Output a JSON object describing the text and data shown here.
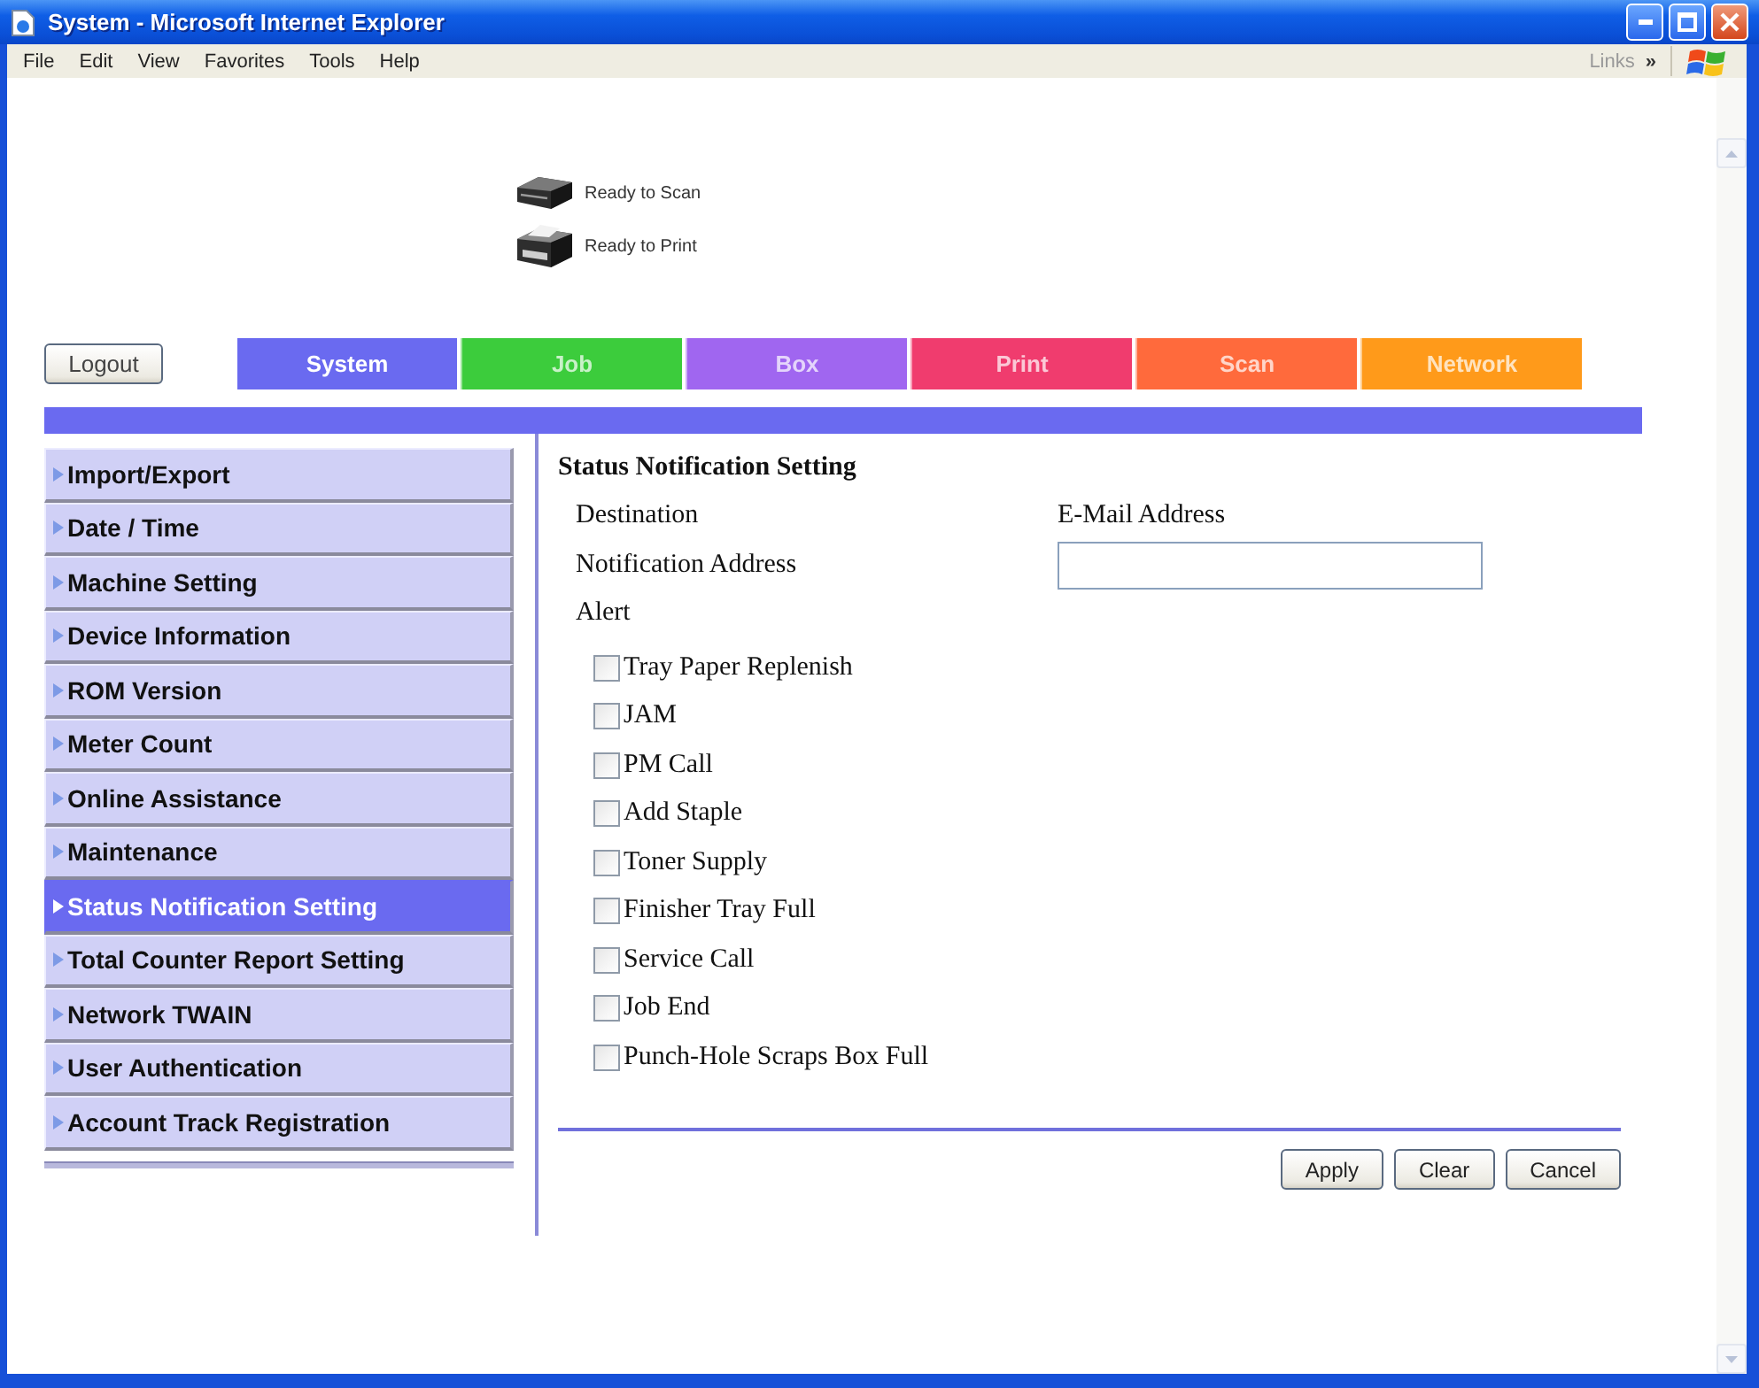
{
  "window": {
    "title": "System - Microsoft Internet Explorer"
  },
  "menu_bar": {
    "items": [
      "File",
      "Edit",
      "View",
      "Favorites",
      "Tools",
      "Help"
    ],
    "links": "Links",
    "chevron": "»"
  },
  "status": [
    {
      "kind": "scanner",
      "text": "Ready to Scan"
    },
    {
      "kind": "printer",
      "text": "Ready to Print"
    }
  ],
  "logout_button": "Logout",
  "tabs": [
    {
      "label": "System",
      "color": "#6a6af0",
      "selected": true
    },
    {
      "label": "Job",
      "color": "#3ccc3c",
      "selected": false
    },
    {
      "label": "Box",
      "color": "#a066f0",
      "selected": false
    },
    {
      "label": "Print",
      "color": "#f03c6e",
      "selected": false
    },
    {
      "label": "Scan",
      "color": "#ff6a3c",
      "selected": false
    },
    {
      "label": "Network",
      "color": "#ff9a1a",
      "selected": false
    }
  ],
  "sidebar": {
    "items": [
      {
        "label": "Import/Export",
        "selected": false
      },
      {
        "label": "Date / Time",
        "selected": false
      },
      {
        "label": "Machine Setting",
        "selected": false
      },
      {
        "label": "Device Information",
        "selected": false
      },
      {
        "label": "ROM Version",
        "selected": false
      },
      {
        "label": "Meter Count",
        "selected": false
      },
      {
        "label": "Online Assistance",
        "selected": false
      },
      {
        "label": "Maintenance",
        "selected": false
      },
      {
        "label": "Status Notification Setting",
        "selected": true
      },
      {
        "label": "Total Counter Report Setting",
        "selected": false
      },
      {
        "label": "Network TWAIN",
        "selected": false
      },
      {
        "label": "User Authentication",
        "selected": false
      },
      {
        "label": "Account Track Registration",
        "selected": false
      }
    ]
  },
  "form": {
    "title": "Status Notification Setting",
    "fields": [
      {
        "kind": "text",
        "label": "Destination",
        "value": "E-Mail Address"
      },
      {
        "kind": "input",
        "label": "Notification Address"
      }
    ],
    "alert_label": "Alert",
    "alerts": [
      {
        "label": "Tray Paper Replenish",
        "checked": false
      },
      {
        "label": "JAM",
        "checked": false
      },
      {
        "label": "PM Call",
        "checked": false
      },
      {
        "label": "Add Staple",
        "checked": false
      },
      {
        "label": "Toner Supply",
        "checked": false
      },
      {
        "label": "Finisher Tray Full",
        "checked": false
      },
      {
        "label": "Service Call",
        "checked": false
      },
      {
        "label": "Job End",
        "checked": false
      },
      {
        "label": "Punch-Hole Scraps Box Full",
        "checked": false
      }
    ]
  },
  "buttons": [
    "Apply",
    "Clear",
    "Cancel"
  ]
}
